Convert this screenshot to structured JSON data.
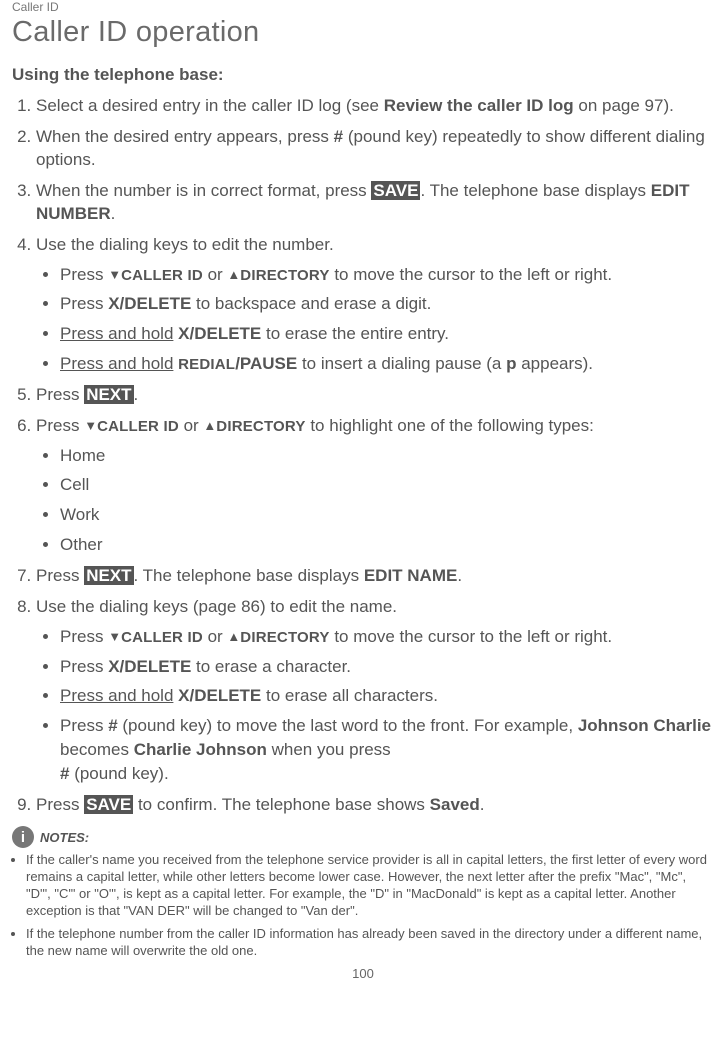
{
  "header_small": "Caller ID",
  "title": "Caller ID operation",
  "subtitle": "Using the telephone base:",
  "step1": {
    "pre": "Select a desired entry in the caller ID log (see ",
    "bold": "Review the caller ID log",
    "post": " on page 97)."
  },
  "step2": {
    "pre": "When the desired entry appears, press ",
    "key": "#",
    "post": " (pound key) repeatedly to show different dialing options."
  },
  "step3": {
    "pre": "When the number is in correct format, press ",
    "save": "SAVE",
    "mid": ". The telephone base displays ",
    "edit": "EDIT NUMBER",
    "end": "."
  },
  "step4": {
    "text": "Use the dialing keys to edit the number.",
    "b1": {
      "press": "Press ",
      "tri_down": "▼",
      "caller": "CALLER ID",
      "or": " or ",
      "tri_up": "▲",
      "dir": "DIRECTORY",
      "post": " to move the cursor to the left or right."
    },
    "b2": {
      "press": "Press ",
      "key": "X/DELETE",
      "post": " to backspace and erase a digit."
    },
    "b3": {
      "press": "Press and hold",
      "sp": " ",
      "key": "X/DELETE",
      "post": " to erase the entire entry."
    },
    "b4": {
      "press": "Press and hold",
      "sp": " ",
      "key1": "REDIAL",
      "key2": "/PAUSE",
      "post1": " to insert a dialing pause (a ",
      "p": "p",
      "post2": " appears)."
    }
  },
  "step5": {
    "press": "Press ",
    "next": "NEXT",
    "end": "."
  },
  "step6": {
    "press": "Press ",
    "tri_down": "▼",
    "caller": "CALLER ID",
    "or": " or ",
    "tri_up": "▲",
    "dir": "DIRECTORY",
    "post": " to highlight one of the following types:",
    "opts": [
      "Home",
      "Cell",
      "Work",
      "Other"
    ]
  },
  "step7": {
    "press": "Press ",
    "next": "NEXT",
    "mid": ". The telephone base displays ",
    "edit": "EDIT NAME",
    "end": "."
  },
  "step8": {
    "text": "Use the dialing keys (page 86) to edit the name.",
    "b1": {
      "press": "Press ",
      "tri_down": "▼",
      "caller": "CALLER ID",
      "or": " or ",
      "tri_up": "▲",
      "dir": "DIRECTORY",
      "post": " to move the cursor to the left or right."
    },
    "b2": {
      "press": "Press ",
      "key": "X/DELETE",
      "post": " to erase a character."
    },
    "b3": {
      "press": "Press and hold",
      "sp": " ",
      "key": "X/DELETE",
      "post": " to erase all characters."
    },
    "b4": {
      "press": "Press ",
      "pound": "#",
      "mid1": " (pound key) to move the last word to the front. For example, ",
      "ex1": "Johnson Charlie",
      "mid2": " becomes ",
      "ex2": "Charlie Johnson",
      "mid3": " when you press ",
      "br_pound": "#",
      "end": " (pound key)."
    }
  },
  "step9": {
    "press": "Press ",
    "save": "SAVE",
    "mid": " to confirm. The telephone base shows ",
    "saved": "Saved",
    "end": "."
  },
  "notes_label": "NOTES:",
  "note1": "If the caller's name you received from the telephone service provider is all in capital letters, the first letter of every word remains a capital letter, while other letters become lower case. However, the next letter after the prefix \"Mac\", \"Mc\", \"D'\", \"C'\" or \"O'\", is kept as a capital letter. For example, the \"D\" in \"MacDonald\" is kept as a capital letter. Another exception is that \"VAN DER\" will be changed to \"Van der\".",
  "note2": "If the telephone number from the caller ID information has already been saved in the directory under a different name, the new name will overwrite the old one.",
  "pagenum": "100",
  "info_glyph": "i"
}
